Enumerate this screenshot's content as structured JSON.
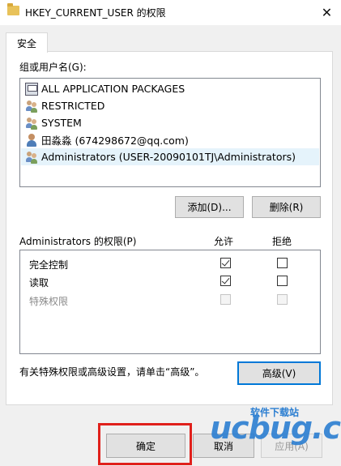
{
  "window": {
    "title": "HKEY_CURRENT_USER 的权限",
    "close_glyph": "✕"
  },
  "tabs": [
    {
      "label": "安全"
    }
  ],
  "groups": {
    "label": "组或用户名(G):",
    "items": [
      {
        "name": "ALL APPLICATION PACKAGES",
        "icon": "app-package-icon"
      },
      {
        "name": "RESTRICTED",
        "icon": "user-group-icon"
      },
      {
        "name": "SYSTEM",
        "icon": "user-group-icon"
      },
      {
        "name": "田淼淼 (674298672@qq.com)",
        "icon": "user-icon"
      },
      {
        "name": "Administrators (USER-20090101TJ\\Administrators)",
        "icon": "user-group-icon",
        "selected": true
      }
    ]
  },
  "buttons": {
    "add": "添加(D)...",
    "remove": "删除(R)",
    "advanced": "高级(V)",
    "ok": "确定",
    "cancel": "取消",
    "apply": "应用(A)"
  },
  "permissions": {
    "header": "Administrators 的权限(P)",
    "allow_label": "允许",
    "deny_label": "拒绝",
    "rows": [
      {
        "name": "完全控制",
        "allow": true,
        "deny": false,
        "disabled": false
      },
      {
        "name": "读取",
        "allow": true,
        "deny": false,
        "disabled": false
      },
      {
        "name": "特殊权限",
        "allow": false,
        "deny": false,
        "disabled": true
      }
    ]
  },
  "advanced_note": "有关特殊权限或高级设置，请单击“高级”。",
  "watermark": {
    "brand": "ucbug.cc",
    "tagline": "软件下载站"
  },
  "colors": {
    "highlight": "#e0201b",
    "focus": "#0078d7",
    "selection": "#e5f3fb",
    "watermark": "#2b7ed1"
  }
}
